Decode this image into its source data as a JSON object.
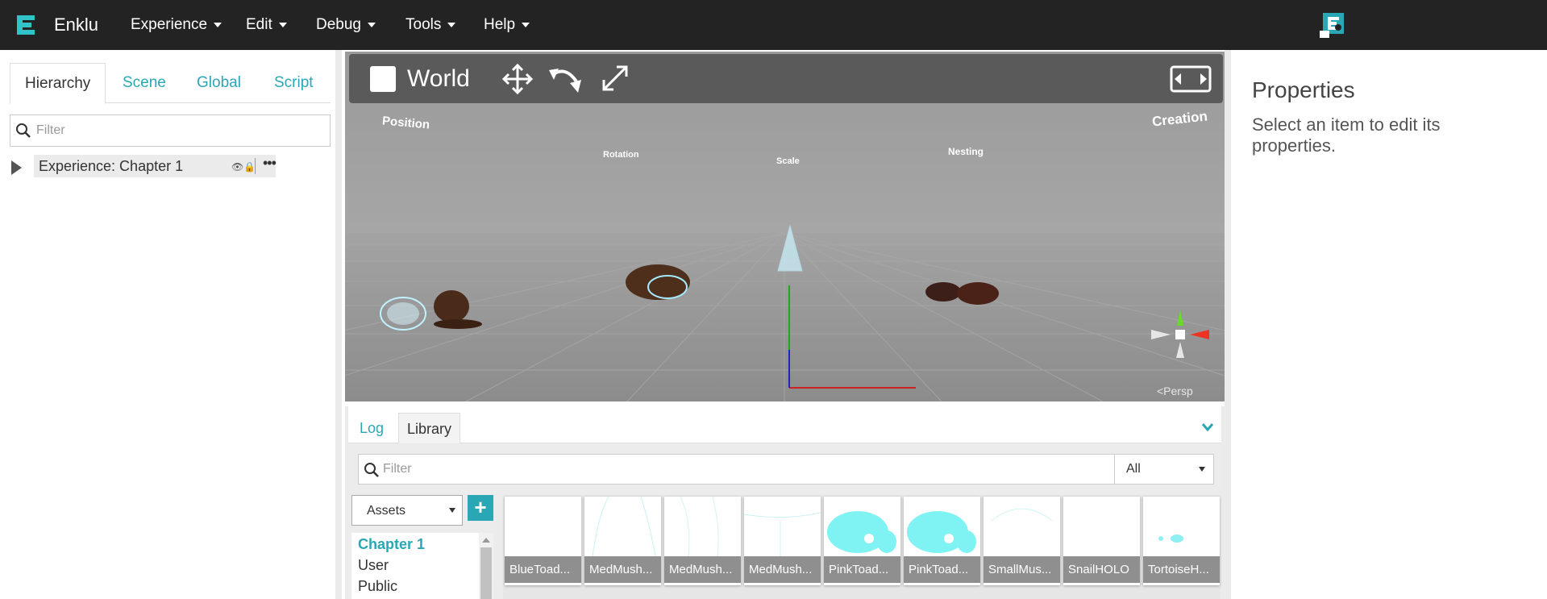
{
  "app": {
    "brand": "Enklu",
    "logo_icon": "enklu-logo-icon",
    "accent_color": "#2aa7b5"
  },
  "menubar": {
    "items": [
      {
        "label": "Experience"
      },
      {
        "label": "Edit"
      },
      {
        "label": "Debug"
      },
      {
        "label": "Tools"
      },
      {
        "label": "Help"
      }
    ]
  },
  "left_panel": {
    "tabs": [
      {
        "label": "Hierarchy"
      },
      {
        "label": "Scene"
      },
      {
        "label": "Global"
      },
      {
        "label": "Script"
      }
    ],
    "active_tab": "Hierarchy",
    "filter": {
      "placeholder": "Filter",
      "value": ""
    },
    "tree": [
      {
        "label": "Experience: Chapter 1",
        "more": "•••"
      }
    ]
  },
  "viewport": {
    "toolbar": {
      "world_label": "World",
      "world_checked": false
    },
    "scene_labels": [
      {
        "text": "Position"
      },
      {
        "text": "Rotation"
      },
      {
        "text": "Scale"
      },
      {
        "text": "Nesting"
      },
      {
        "text": "Creation"
      }
    ],
    "perspective_label": "<Persp"
  },
  "bottom_panel": {
    "tabs": [
      {
        "label": "Log"
      },
      {
        "label": "Library"
      }
    ],
    "active_tab": "Library",
    "filter": {
      "placeholder": "Filter",
      "value": ""
    },
    "type_select": "All",
    "source_select": "Assets",
    "add_label": "+",
    "sources": [
      {
        "label": "Chapter 1",
        "active": true
      },
      {
        "label": "User",
        "active": false
      },
      {
        "label": "Public",
        "active": false
      }
    ],
    "assets": [
      {
        "label": "BlueToad..."
      },
      {
        "label": "MedMush..."
      },
      {
        "label": "MedMush..."
      },
      {
        "label": "MedMush..."
      },
      {
        "label": "PinkToad..."
      },
      {
        "label": "PinkToad..."
      },
      {
        "label": "SmallMus..."
      },
      {
        "label": "SnailHOLO"
      },
      {
        "label": "TortoiseH..."
      }
    ]
  },
  "right_panel": {
    "title": "Properties",
    "hint": "Select an item to edit its properties."
  }
}
